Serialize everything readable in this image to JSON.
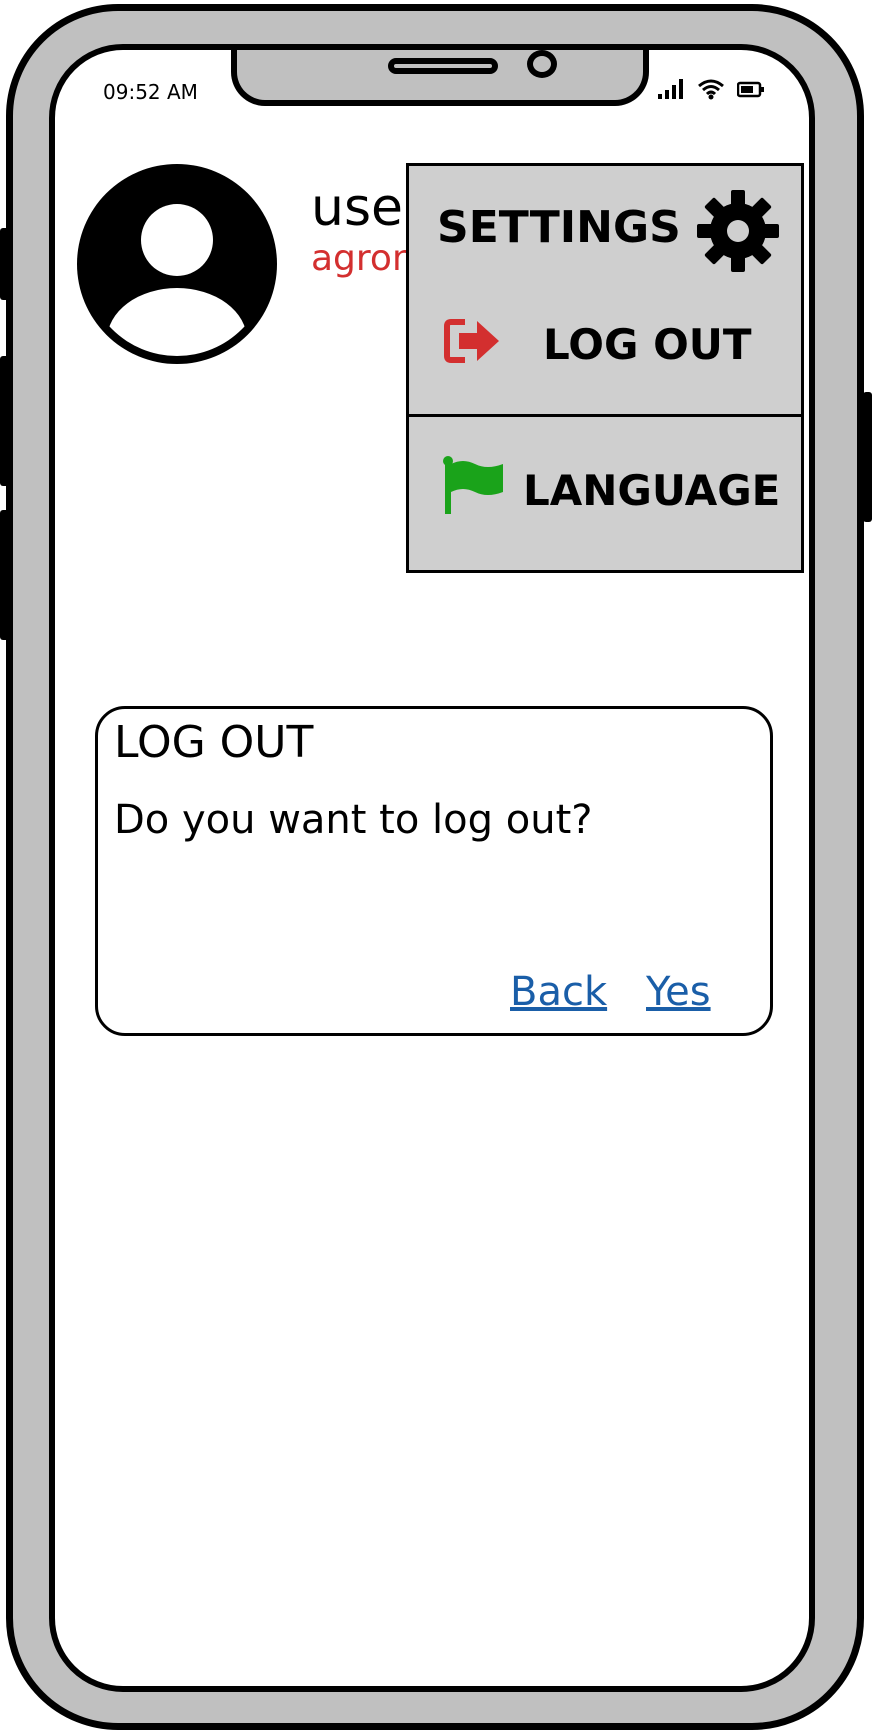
{
  "status_bar": {
    "time": "09:52 AM",
    "icons": [
      "signal-icon",
      "wifi-icon",
      "battery-icon"
    ]
  },
  "profile": {
    "username": "use",
    "user_type": "agron",
    "avatar_icon": "user-avatar-icon"
  },
  "menu": {
    "settings_label": "SETTINGS",
    "settings_icon": "gear-icon",
    "logout_label": "LOG OUT",
    "logout_icon": "logout-arrow-icon",
    "language_label": "LANGUAGE",
    "language_icon": "flag-icon"
  },
  "dialog": {
    "title": "LOG OUT",
    "message": "Do you want to log out?",
    "back_label": "Back",
    "yes_label": "Yes"
  },
  "colors": {
    "accent_red": "#d32f2f",
    "link_blue": "#1a5ea8",
    "flag_green": "#1aa31a",
    "frame_gray": "#c0c0c0",
    "menu_gray": "#cfcfcf"
  }
}
